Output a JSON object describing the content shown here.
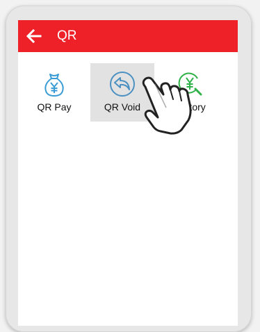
{
  "appbar": {
    "title": "QR",
    "color": "#ee2128",
    "back_icon": "arrow-left-icon"
  },
  "actions": [
    {
      "label": "QR Pay",
      "icon": "money-bag-yen-icon",
      "color": "#3a9bd5",
      "selected": false
    },
    {
      "label": "QR Void",
      "icon": "undo-circle-icon",
      "color": "#4a90c2",
      "selected": true
    },
    {
      "label": "History",
      "icon": "yen-search-icon",
      "color": "#2fb24a",
      "selected": false
    }
  ],
  "pointer": {
    "icon": "hand-pointer-icon"
  }
}
